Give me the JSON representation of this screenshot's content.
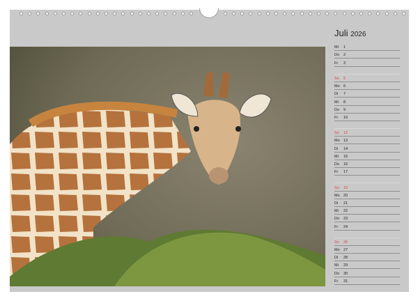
{
  "calendar": {
    "month": "Juli",
    "year": "2026"
  },
  "days": [
    {
      "wd": "Mi",
      "d": "1"
    },
    {
      "wd": "Do",
      "d": "2"
    },
    {
      "wd": "Fr",
      "d": "3"
    },
    {
      "wd": "",
      "d": ""
    },
    {
      "wd": "So",
      "d": "5",
      "sun": true
    },
    {
      "wd": "Mo",
      "d": "6"
    },
    {
      "wd": "Di",
      "d": "7"
    },
    {
      "wd": "Mi",
      "d": "8"
    },
    {
      "wd": "Do",
      "d": "9"
    },
    {
      "wd": "Fr",
      "d": "10"
    },
    {
      "wd": "",
      "d": ""
    },
    {
      "wd": "So",
      "d": "12",
      "sun": true
    },
    {
      "wd": "Mo",
      "d": "13"
    },
    {
      "wd": "Di",
      "d": "14"
    },
    {
      "wd": "Mi",
      "d": "15"
    },
    {
      "wd": "Do",
      "d": "16"
    },
    {
      "wd": "Fr",
      "d": "17"
    },
    {
      "wd": "",
      "d": ""
    },
    {
      "wd": "So",
      "d": "19",
      "sun": true
    },
    {
      "wd": "Mo",
      "d": "20"
    },
    {
      "wd": "Di",
      "d": "21"
    },
    {
      "wd": "Mi",
      "d": "22"
    },
    {
      "wd": "Do",
      "d": "23"
    },
    {
      "wd": "Fr",
      "d": "24"
    },
    {
      "wd": "",
      "d": ""
    },
    {
      "wd": "So",
      "d": "26",
      "sun": true
    },
    {
      "wd": "Mo",
      "d": "27"
    },
    {
      "wd": "Di",
      "d": "28"
    },
    {
      "wd": "Mi",
      "d": "29"
    },
    {
      "wd": "Do",
      "d": "30"
    },
    {
      "wd": "Fr",
      "d": "31"
    }
  ],
  "colors": {
    "page": "#c9c9c9",
    "sunday": "#d44444"
  }
}
